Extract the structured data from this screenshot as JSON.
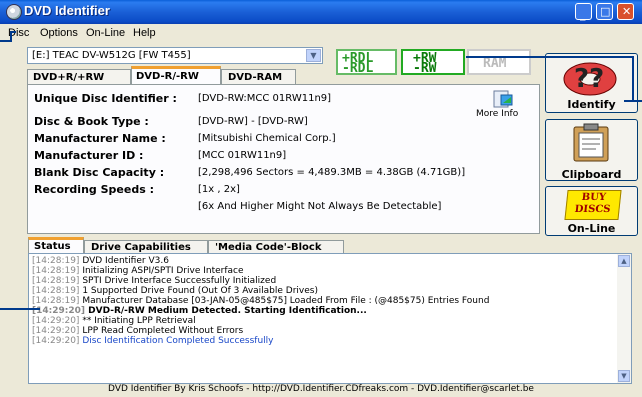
{
  "window": {
    "title": "DVD Identifier"
  },
  "menu": [
    "Disc",
    "Options",
    "On-Line",
    "Help"
  ],
  "drive": {
    "selected": "[E:] TEAC DV-W512G [FW T455]"
  },
  "format_logos": {
    "dvdr": [
      "+RDL",
      "-RDL"
    ],
    "dvdrw": [
      "+RW",
      "-RW"
    ],
    "dvdram": "RAM"
  },
  "top_tabs": [
    "DVD+R/+RW",
    "DVD-R/-RW",
    "DVD-RAM"
  ],
  "disc_info": {
    "uid_label": "Unique Disc Identifier :",
    "uid_value": "[DVD-RW:MCC 01RW11n9]",
    "more_info": "More Info",
    "rows": [
      {
        "label": "Disc & Book Type :",
        "value": "[DVD-RW] - [DVD-RW]"
      },
      {
        "label": "Manufacturer Name :",
        "value": "[Mitsubishi Chemical Corp.]"
      },
      {
        "label": "Manufacturer ID :",
        "value": "[MCC 01RW11n9]"
      },
      {
        "label": "Blank Disc Capacity :",
        "value": "[2,298,496 Sectors = 4,489.3MB = 4.38GB (4.71GB)]"
      },
      {
        "label": "Recording Speeds :",
        "value": "[1x , 2x]"
      }
    ],
    "speed_note": "[6x And Higher Might Not Always Be Detectable]"
  },
  "side_buttons": {
    "identify": "Identify",
    "clipboard": "Clipboard",
    "buy_line1": "BUY",
    "buy_line2": "DISCS",
    "online": "On-Line"
  },
  "bottom_tabs": [
    "Status",
    "Drive Capabilities",
    "'Media Code'-Block"
  ],
  "log": [
    {
      "ts": "[14:28:19]",
      "msg": "DVD Identifier V3.6",
      "style": "normal"
    },
    {
      "ts": "[14:28:19]",
      "msg": "Initializing ASPI/SPTI Drive Interface",
      "style": "normal"
    },
    {
      "ts": "[14:28:19]",
      "msg": "SPTI Drive Interface Successfully Initialized",
      "style": "normal"
    },
    {
      "ts": "[14:28:19]",
      "msg": "1 Supported Drive Found (Out Of 3 Available Drives)",
      "style": "normal"
    },
    {
      "ts": "[14:28:19]",
      "msg": "Manufacturer Database [03-JAN-05@485$75] Loaded From File : (@485$75) Entries Found",
      "style": "normal"
    },
    {
      "ts": "[14:29:20]",
      "msg": "DVD-R/-RW Medium Detected. Starting Identification...",
      "style": "bold"
    },
    {
      "ts": "[14:29:20]",
      "msg": "** Initiating LPP Retrieval",
      "style": "normal"
    },
    {
      "ts": "[14:29:20]",
      "msg": "LPP Read Completed Without Errors",
      "style": "normal"
    },
    {
      "ts": "[14:29:20]",
      "msg": "Disc Identification Completed Successfully",
      "style": "blue"
    }
  ],
  "status_bar": "DVD Identifier By Kris Schoofs  -  http://DVD.Identifier.CDfreaks.com  -  DVD.Identifier@scarlet.be",
  "colors": {
    "title": "#0b4bc6",
    "accent_tab": "#f0a030",
    "log_blue": "#1a48c8"
  }
}
